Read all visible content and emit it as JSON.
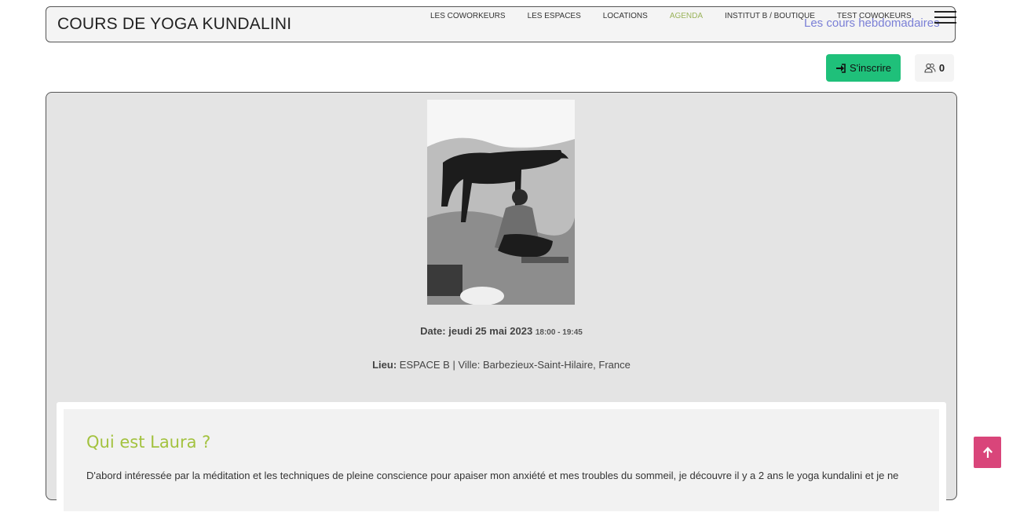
{
  "header": {
    "title": "COURS DE YOGA KUNDALINI",
    "nav": [
      {
        "label": "LES COWORKEURS"
      },
      {
        "label": "LES ESPACES"
      },
      {
        "label": "LOCATIONS"
      },
      {
        "label": "AGENDA"
      },
      {
        "label": "INSTITUT B / BOUTIQUE"
      },
      {
        "label": "TEST COWOKEURS"
      }
    ],
    "active_nav": "AGENDA",
    "subtitle_link": "Les cours hebdomadaires"
  },
  "actions": {
    "register_label": "S'inscrire",
    "attendee_count": "0"
  },
  "event": {
    "date_label": "Date:",
    "date_value": "jeudi 25 mai 2023",
    "time_value": "18:00 - 19:45",
    "place_label": "Lieu:",
    "place_value": "ESPACE B | Ville: Barbezieux-Saint-Hilaire, France"
  },
  "about": {
    "title": "Qui est Laura ?",
    "text": "D'abord intéressée par la méditation et les techniques de pleine conscience pour apaiser mon anxiété et mes troubles du sommeil, je découvre il y a 2 ans le yoga kundalini et je ne"
  },
  "colors": {
    "accent_green": "#1fc07a",
    "title_green": "#a3c23f",
    "link_purple": "#7a7fd6",
    "active_nav": "#9ab35a",
    "back_to_top": "#d9457a"
  }
}
